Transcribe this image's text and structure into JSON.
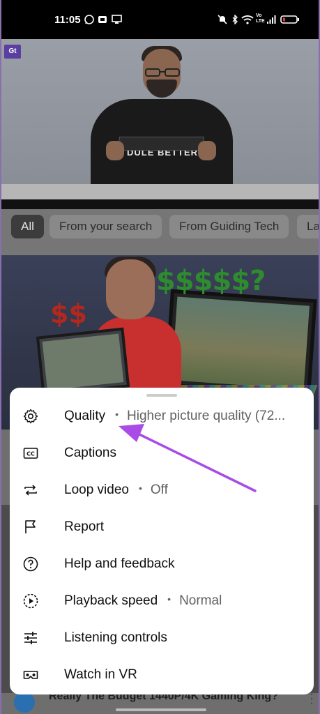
{
  "status_bar": {
    "time": "11:05",
    "icons": [
      "whatsapp-icon",
      "notification-icon",
      "screen-icon",
      "mute-icon",
      "bluetooth-icon",
      "wifi-icon",
      "signal-icon",
      "battery-icon"
    ],
    "network_label": "Vo LTE"
  },
  "player": {
    "channel_logo": "Gt",
    "shirt_text": "DULE BETTER"
  },
  "chips": [
    {
      "label": "All",
      "active": true
    },
    {
      "label": "From your search",
      "active": false
    },
    {
      "label": "From Guiding Tech",
      "active": false
    },
    {
      "label": "La",
      "active": false
    }
  ],
  "thumbnail": {
    "overlay_small": "$$",
    "overlay_large": "$$$$$?"
  },
  "menu": {
    "items": [
      {
        "label": "Quality",
        "value": "Higher picture quality (72...",
        "icon": "gear-icon"
      },
      {
        "label": "Captions",
        "value": "",
        "icon": "cc-icon"
      },
      {
        "label": "Loop video",
        "value": "Off",
        "icon": "loop-icon"
      },
      {
        "label": "Report",
        "value": "",
        "icon": "flag-icon"
      },
      {
        "label": "Help and feedback",
        "value": "",
        "icon": "help-icon"
      },
      {
        "label": "Playback speed",
        "value": "Normal",
        "icon": "playback-speed-icon"
      },
      {
        "label": "Listening controls",
        "value": "",
        "icon": "sliders-icon"
      },
      {
        "label": "Watch in VR",
        "value": "",
        "icon": "vr-icon"
      }
    ],
    "separator": "•"
  },
  "next_video": {
    "title": "Really The Budget 1440P/4K Gaming King?"
  },
  "colors": {
    "annotation_arrow": "#a94be6",
    "sheet_bg": "#ffffff"
  }
}
